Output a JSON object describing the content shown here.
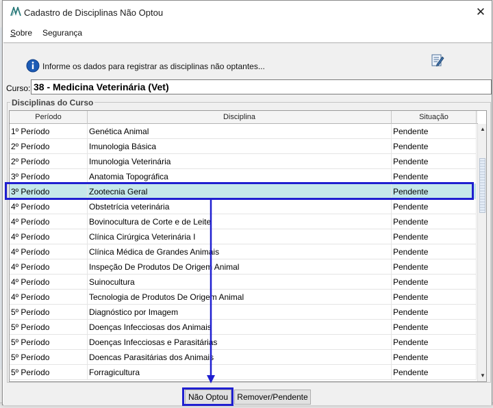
{
  "window": {
    "title": "Cadastro de Disciplinas Não Optou",
    "close_glyph": "✕"
  },
  "menu": {
    "items": [
      {
        "label": "Sobre",
        "accel": "S",
        "rest": "obre"
      },
      {
        "label": "Segurança",
        "accel": "",
        "rest": "Segurança"
      }
    ]
  },
  "info": {
    "text": "Informe os dados para registrar as disciplinas não optantes..."
  },
  "curso": {
    "label": "Curso:",
    "value": "38 - Medicina Veterinária (Vet)"
  },
  "group": {
    "title": "Disciplinas do Curso"
  },
  "table": {
    "columns": [
      "Período",
      "Disciplina",
      "Situação"
    ],
    "rows": [
      {
        "periodo": "1º Período",
        "disciplina": "Genética Animal",
        "situacao": "Pendente"
      },
      {
        "periodo": "2º Período",
        "disciplina": " Imunologia Básica",
        "situacao": "Pendente"
      },
      {
        "periodo": "2º Período",
        "disciplina": "Imunologia Veterinária",
        "situacao": "Pendente"
      },
      {
        "periodo": "3º Período",
        "disciplina": "Anatomia Topográfica",
        "situacao": "Pendente"
      },
      {
        "periodo": "3º Período",
        "disciplina": "Zootecnia Geral",
        "situacao": "Pendente",
        "selected": true
      },
      {
        "periodo": "4º Período",
        "disciplina": " Obstetrícia veterinária",
        "situacao": "Pendente"
      },
      {
        "periodo": "4º Período",
        "disciplina": "Bovinocultura de Corte e de Leite",
        "situacao": "Pendente"
      },
      {
        "periodo": "4º Período",
        "disciplina": "Clínica Cirúrgica Veterinária I",
        "situacao": "Pendente"
      },
      {
        "periodo": "4º Período",
        "disciplina": "Clínica Médica de Grandes Animais",
        "situacao": "Pendente"
      },
      {
        "periodo": "4º Período",
        "disciplina": "Inspeção De Produtos De Origem Animal",
        "situacao": "Pendente"
      },
      {
        "periodo": "4º Período",
        "disciplina": "Suinocultura",
        "situacao": "Pendente"
      },
      {
        "periodo": "4º Período",
        "disciplina": "Tecnologia de Produtos De Origem Animal",
        "situacao": "Pendente"
      },
      {
        "periodo": "5º Período",
        "disciplina": "Diagnóstico por Imagem",
        "situacao": "Pendente"
      },
      {
        "periodo": "5º Período",
        "disciplina": "Doenças Infecciosas dos Animais",
        "situacao": "Pendente"
      },
      {
        "periodo": "5º Período",
        "disciplina": "Doenças Infecciosas e Parasitárias",
        "situacao": "Pendente"
      },
      {
        "periodo": "5º Período",
        "disciplina": "Doencas Parasitárias dos Animais",
        "situacao": "Pendente"
      },
      {
        "periodo": "5º Período",
        "disciplina": "Forragicultura",
        "situacao": "Pendente"
      }
    ]
  },
  "scrollbar": {
    "up_glyph": "▲",
    "down_glyph": "▼"
  },
  "buttons": {
    "nao_optou": "Não Optou",
    "remover_pendente": "Remover/Pendente"
  },
  "colors": {
    "selection": "#c5e8ea",
    "annotation": "#1f1fd0",
    "info_icon": "#1c5bb5",
    "logo": "#2a7a7a"
  },
  "icons": {
    "logo": "app-logo-icon",
    "info": "info-icon",
    "edit": "edit-form-icon",
    "close": "close-icon"
  }
}
